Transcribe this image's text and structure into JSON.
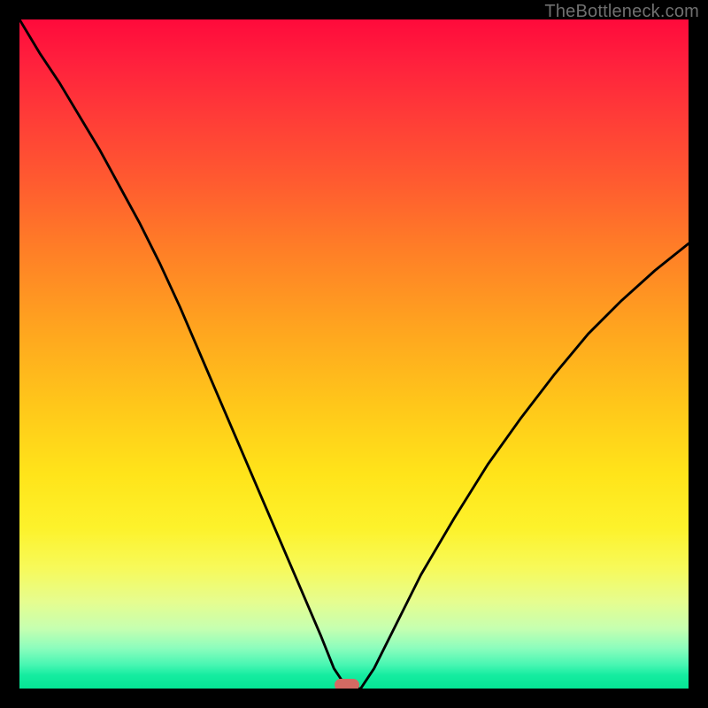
{
  "watermark": {
    "text": "TheBottleneck.com"
  },
  "chart_data": {
    "type": "line",
    "title": "",
    "xlabel": "",
    "ylabel": "",
    "xlim": [
      0,
      100
    ],
    "ylim": [
      0,
      100
    ],
    "grid": false,
    "legend": false,
    "marker": {
      "x": 49,
      "y": 0,
      "color": "#d46a63"
    },
    "gradient_stops": [
      {
        "pos": 0,
        "color": "#ff0a3b"
      },
      {
        "pos": 0.06,
        "color": "#ff1f3d"
      },
      {
        "pos": 0.14,
        "color": "#ff3a38"
      },
      {
        "pos": 0.24,
        "color": "#ff5a30"
      },
      {
        "pos": 0.34,
        "color": "#ff7d27"
      },
      {
        "pos": 0.46,
        "color": "#ffa41f"
      },
      {
        "pos": 0.58,
        "color": "#ffc81a"
      },
      {
        "pos": 0.68,
        "color": "#ffe41a"
      },
      {
        "pos": 0.76,
        "color": "#fdf22b"
      },
      {
        "pos": 0.82,
        "color": "#f7fa5a"
      },
      {
        "pos": 0.87,
        "color": "#e6fd8f"
      },
      {
        "pos": 0.91,
        "color": "#c6ffb0"
      },
      {
        "pos": 0.94,
        "color": "#8bfdbd"
      },
      {
        "pos": 0.965,
        "color": "#46f6b2"
      },
      {
        "pos": 0.98,
        "color": "#15eca0"
      },
      {
        "pos": 1.0,
        "color": "#05e695"
      }
    ],
    "series": [
      {
        "name": "bottleneck-curve",
        "x": [
          0,
          3,
          6,
          9,
          12,
          15,
          18,
          21,
          24,
          27,
          30,
          33,
          36,
          39,
          42,
          45,
          47,
          49,
          51,
          53,
          56,
          60,
          65,
          70,
          75,
          80,
          85,
          90,
          95,
          100
        ],
        "y": [
          100,
          95,
          90.5,
          85.5,
          80.5,
          75,
          69.5,
          63.5,
          57,
          50,
          43,
          36,
          29,
          22,
          15,
          8,
          3,
          0,
          0,
          3,
          9,
          17,
          25.5,
          33.5,
          40.5,
          47,
          53,
          58,
          62.5,
          66.5
        ]
      }
    ]
  }
}
